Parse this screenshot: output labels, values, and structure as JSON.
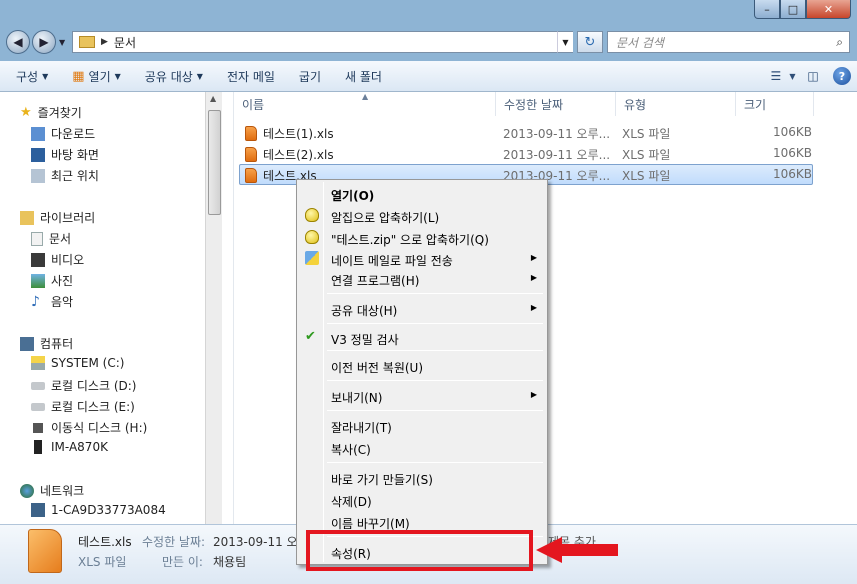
{
  "window": {
    "caption": {
      "minimize": "–",
      "maximize": "□",
      "close": "✕"
    }
  },
  "address": {
    "path": "문서",
    "search_placeholder": "문서 검색"
  },
  "toolbar": {
    "organize": "구성",
    "open": "열기",
    "share": "공유 대상",
    "email": "전자 메일",
    "burn": "굽기",
    "new_folder": "새 폴더"
  },
  "nav": {
    "favorites": "즐겨찾기",
    "downloads": "다운로드",
    "desktop": "바탕 화면",
    "recent": "최근 위치",
    "libraries": "라이브러리",
    "documents": "문서",
    "videos": "비디오",
    "pictures": "사진",
    "music": "음악",
    "computer": "컴퓨터",
    "drive_c": "SYSTEM (C:)",
    "drive_d": "로컬 디스크 (D:)",
    "drive_e": "로컬 디스크 (E:)",
    "drive_h": "이동식 디스크 (H:)",
    "device": "IM-A870K",
    "network": "네트워크",
    "net_pc": "1-CA9D33773A084"
  },
  "columns": {
    "name": "이름",
    "modified": "수정한 날짜",
    "type": "유형",
    "size": "크기"
  },
  "files": [
    {
      "name": "테스트(1).xls",
      "modified": "2013-09-11 오루...",
      "type": "XLS 파일",
      "size": "106KB"
    },
    {
      "name": "테스트(2).xls",
      "modified": "2013-09-11 오루...",
      "type": "XLS 파일",
      "size": "106KB"
    },
    {
      "name": "테스트.xls",
      "modified": "2013-09-11 오루...",
      "type": "XLS 파일",
      "size": "106KB"
    }
  ],
  "details": {
    "filename": "테스트.xls",
    "modified_label": "수정한 날짜:",
    "modified_value": "2013-09-11 오",
    "filetype": "XLS 파일",
    "author_label": "만든 이:",
    "author_value": "채용팀",
    "tag_fragment": "제목 추가"
  },
  "context_menu": {
    "open": "열기(O)",
    "compress_alzip": "알집으로 압축하기(L)",
    "compress_zip": "\"테스트.zip\" 으로 압축하기(Q)",
    "send_naver_mail": "네이트 메일로 파일 전송",
    "open_with": "연결 프로그램(H)",
    "share_with": "공유 대상(H)",
    "v3_scan": "V3 정밀 검사",
    "restore_versions": "이전 버전 복원(U)",
    "send_to": "보내기(N)",
    "cut": "잘라내기(T)",
    "copy": "복사(C)",
    "create_shortcut": "바로 가기 만들기(S)",
    "delete": "삭제(D)",
    "rename": "이름 바꾸기(M)",
    "properties": "속성(R)"
  },
  "colors": {
    "highlight": "#e4161f",
    "selection": "#c1dcfc"
  }
}
